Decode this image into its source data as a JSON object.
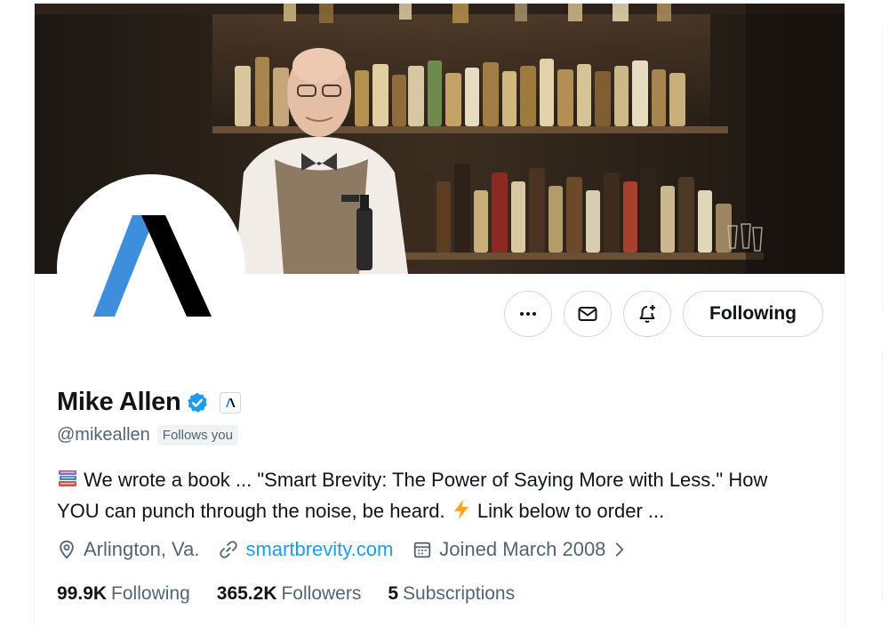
{
  "profile": {
    "display_name": "Mike Allen",
    "handle": "@mikeallen",
    "follows_you": "Follows you",
    "bio_line1": "We wrote a book ... \"Smart Brevity: The Power of Saying More with Less.\" How",
    "bio_line2a": "YOU can punch through the noise, be heard.",
    "bio_line2b": "Link below to order ...",
    "location": "Arlington, Va.",
    "website": "smartbrevity.com",
    "joined": "Joined March 2008"
  },
  "actions": {
    "following_label": "Following"
  },
  "stats": {
    "following_count": "99.9K",
    "following_label": "Following",
    "followers_count": "365.2K",
    "followers_label": "Followers",
    "subscriptions_count": "5",
    "subscriptions_label": "Subscriptions"
  },
  "colors": {
    "link": "#1d9bf0",
    "verified": "#1d9bf0",
    "logo_blue": "#3e8ede",
    "logo_black": "#000000"
  }
}
